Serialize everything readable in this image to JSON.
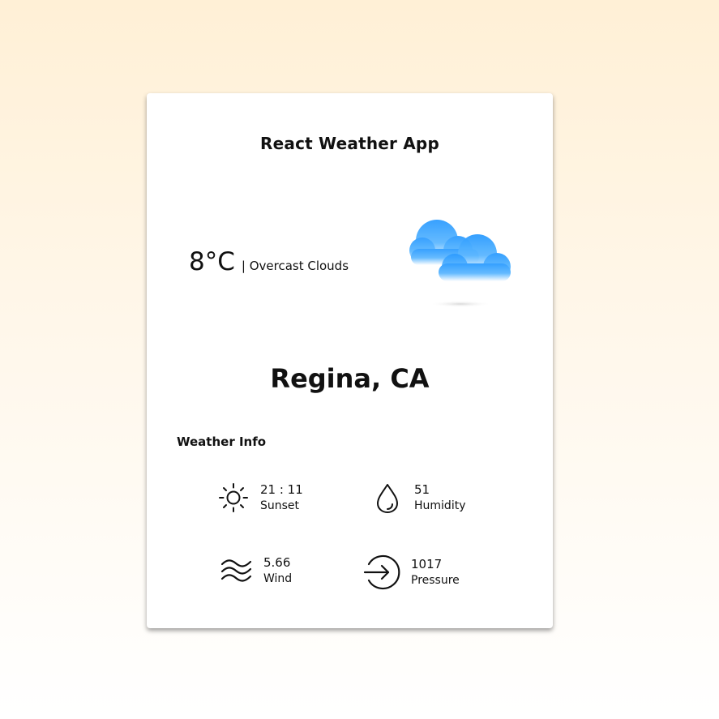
{
  "app": {
    "title": "React Weather App"
  },
  "current": {
    "temperature": "8°C",
    "description": "| Overcast Clouds",
    "icon": "overcast-clouds-icon",
    "icon_color": "#2d9cff"
  },
  "location": {
    "city": "Regina, CA"
  },
  "weather_info": {
    "title": "Weather Info",
    "items": [
      {
        "value": "21 : 11",
        "label": "Sunset",
        "icon": "sun-icon"
      },
      {
        "value": "51",
        "label": "Humidity",
        "icon": "drop-icon"
      },
      {
        "value": "5.66",
        "label": "Wind",
        "icon": "wind-icon"
      },
      {
        "value": "1017",
        "label": "Pressure",
        "icon": "pressure-icon"
      }
    ]
  }
}
